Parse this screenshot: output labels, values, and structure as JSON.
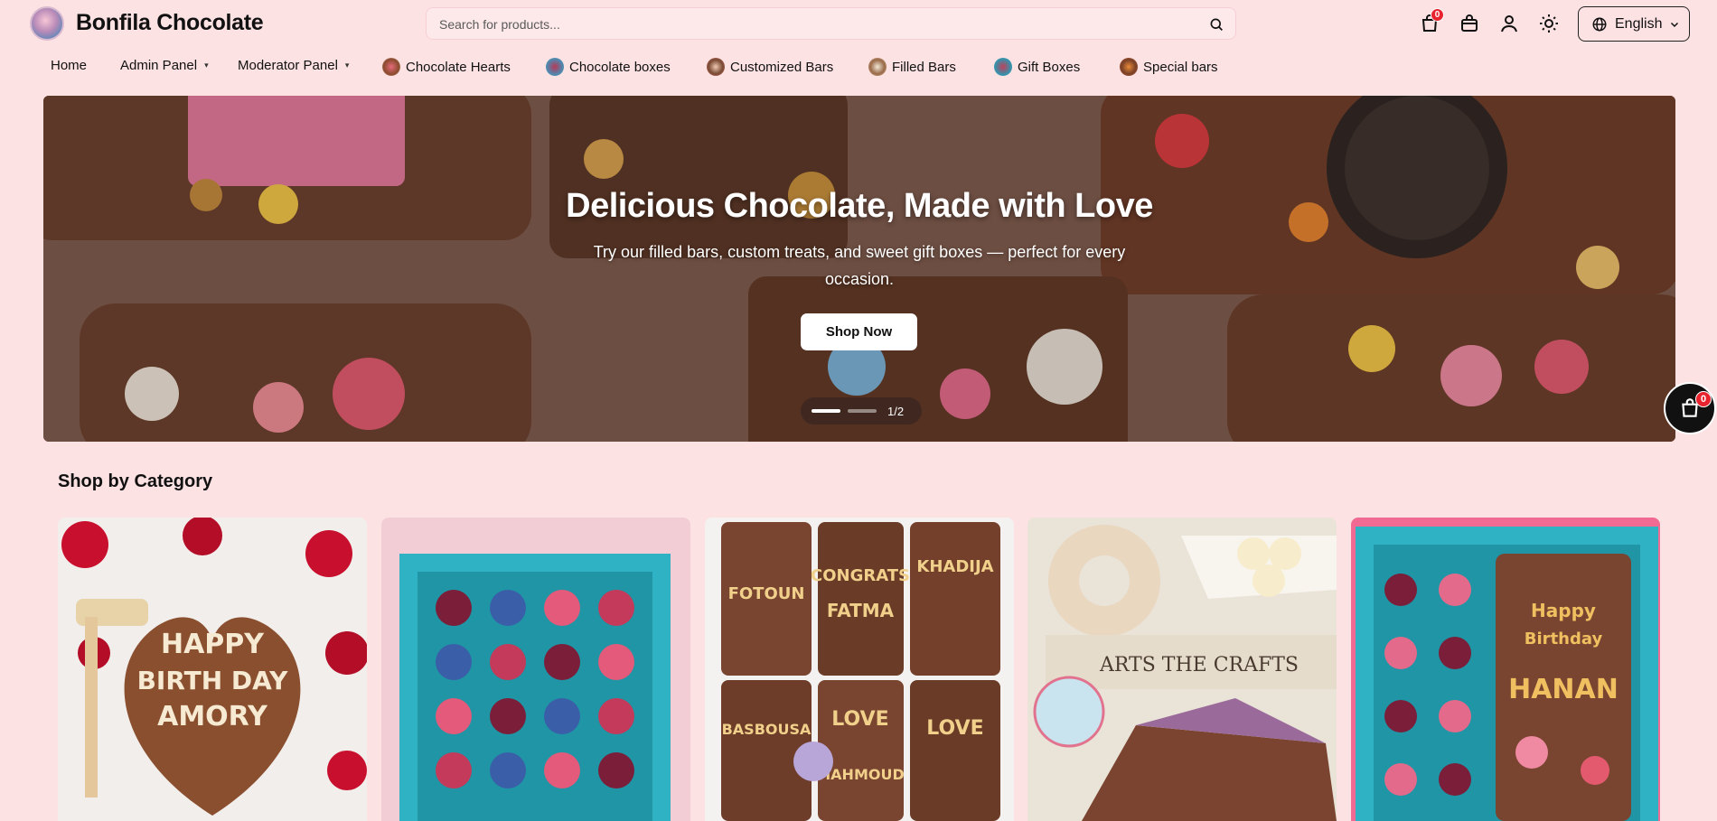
{
  "header": {
    "brand": "Bonfila Chocolate",
    "search_placeholder": "Search for products...",
    "orders_badge": "0",
    "language": "English",
    "icons": [
      "shopping-bag-icon",
      "store-icon",
      "user-icon",
      "sun-icon",
      "globe-icon",
      "chevron-down-icon",
      "search-icon"
    ]
  },
  "nav": {
    "items": [
      {
        "label": "Home"
      },
      {
        "label": "Admin Panel"
      },
      {
        "label": "Moderator Panel"
      },
      {
        "label": "Chocolate Hearts"
      },
      {
        "label": "Chocolate boxes"
      },
      {
        "label": "Customized Bars"
      },
      {
        "label": "Filled Bars"
      },
      {
        "label": "Gift Boxes"
      },
      {
        "label": "Special bars"
      }
    ]
  },
  "hero": {
    "title": "Delicious Chocolate, Made with Love",
    "subtitle": "Try our filled bars, custom treats, and sweet gift boxes — perfect for every occasion.",
    "button": "Shop Now",
    "slide_indicator": "1/2"
  },
  "floating_cart": {
    "badge": "0"
  },
  "categories": {
    "title": "Shop by Category",
    "cards": [
      {
        "name": "heart-cake-image"
      },
      {
        "name": "bonbon-box-image"
      },
      {
        "name": "custom-bars-image"
      },
      {
        "name": "filled-bar-image"
      },
      {
        "name": "gift-box-image"
      }
    ]
  },
  "colors": {
    "page_bg": "#fde2e4",
    "badge": "#e8232e",
    "chocolate": "#6b4634",
    "box_teal": "#2fb3c4"
  }
}
